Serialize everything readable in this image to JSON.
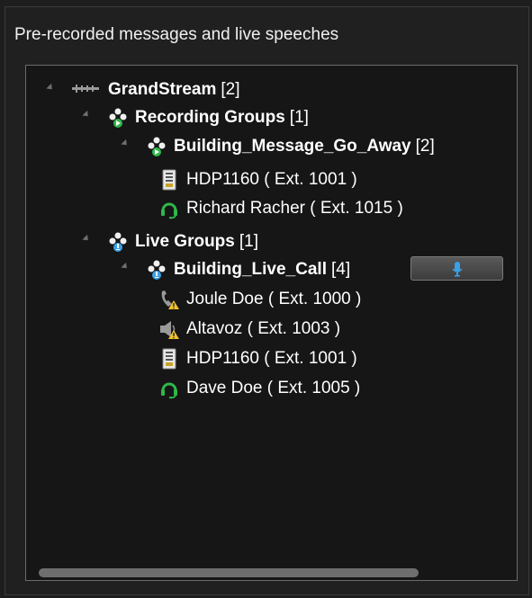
{
  "panel": {
    "title": "Pre-recorded messages and live speeches"
  },
  "tree": {
    "root": {
      "label": "GrandStream",
      "count": "[2]",
      "icon": "network-icon"
    },
    "recording_groups": {
      "label": "Recording Groups",
      "count": "[1]",
      "icon": "recording-group-icon"
    },
    "recording_group_1": {
      "label": "Building_Message_Go_Away",
      "count": "[2]",
      "icon": "recording-group-icon"
    },
    "recording_members": [
      {
        "label": "HDP1160 ( Ext. 1001 )",
        "icon": "paging-device-icon"
      },
      {
        "label": "Richard Racher ( Ext. 1015 )",
        "icon": "headset-icon"
      }
    ],
    "live_groups": {
      "label": "Live Groups",
      "count": "[1]",
      "icon": "live-group-icon"
    },
    "live_group_1": {
      "label": "Building_Live_Call",
      "count": "[4]",
      "icon": "live-group-icon"
    },
    "live_members": [
      {
        "label": "Joule Doe ( Ext. 1000 )",
        "icon": "phone-warning-icon"
      },
      {
        "label": "Altavoz ( Ext. 1003 )",
        "icon": "speaker-warning-icon"
      },
      {
        "label": "HDP1160 ( Ext. 1001 )",
        "icon": "paging-device-icon"
      },
      {
        "label": "Dave Doe ( Ext. 1005 )",
        "icon": "headset-icon"
      }
    ]
  },
  "live_call_button": {
    "icon": "microphone-icon"
  },
  "colors": {
    "background": "#1e1e1e",
    "tree_background": "#161616",
    "accent_green": "#2fb84a",
    "accent_blue": "#3aa0e8",
    "warning_yellow": "#f2c12e"
  }
}
